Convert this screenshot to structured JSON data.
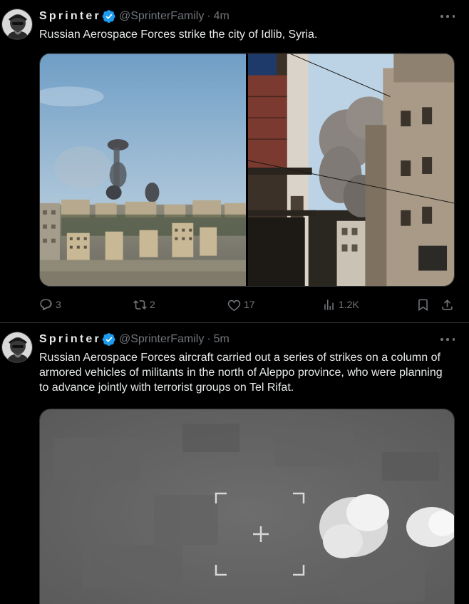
{
  "tweets": [
    {
      "display_name": "Sprinter",
      "handle": "@SprinterFamily",
      "separator": "·",
      "time": "4m",
      "text": "Russian Aerospace Forces strike the city of Idlib, Syria.",
      "replies": "3",
      "reposts": "2",
      "likes": "17",
      "views": "1.2K"
    },
    {
      "display_name": "Sprinter",
      "handle": "@SprinterFamily",
      "separator": "·",
      "time": "5m",
      "text": "Russian Aerospace Forces aircraft carried out a series of strikes on a column of armored vehicles of militants in the north of Aleppo province, who were planning to advance jointly with terrorist groups on Tel Rifat."
    }
  ],
  "colors": {
    "background": "#000000",
    "text": "#e7e9ea",
    "secondary_text": "#71767b",
    "verified_badge": "#1d9bf0",
    "divider": "#2f3336"
  },
  "icons": {
    "reply": "reply-icon",
    "repost": "repost-icon",
    "like": "like-icon",
    "views": "views-icon",
    "bookmark": "bookmark-icon",
    "share": "share-icon",
    "more": "more-icon",
    "verified": "verified-badge-icon"
  }
}
